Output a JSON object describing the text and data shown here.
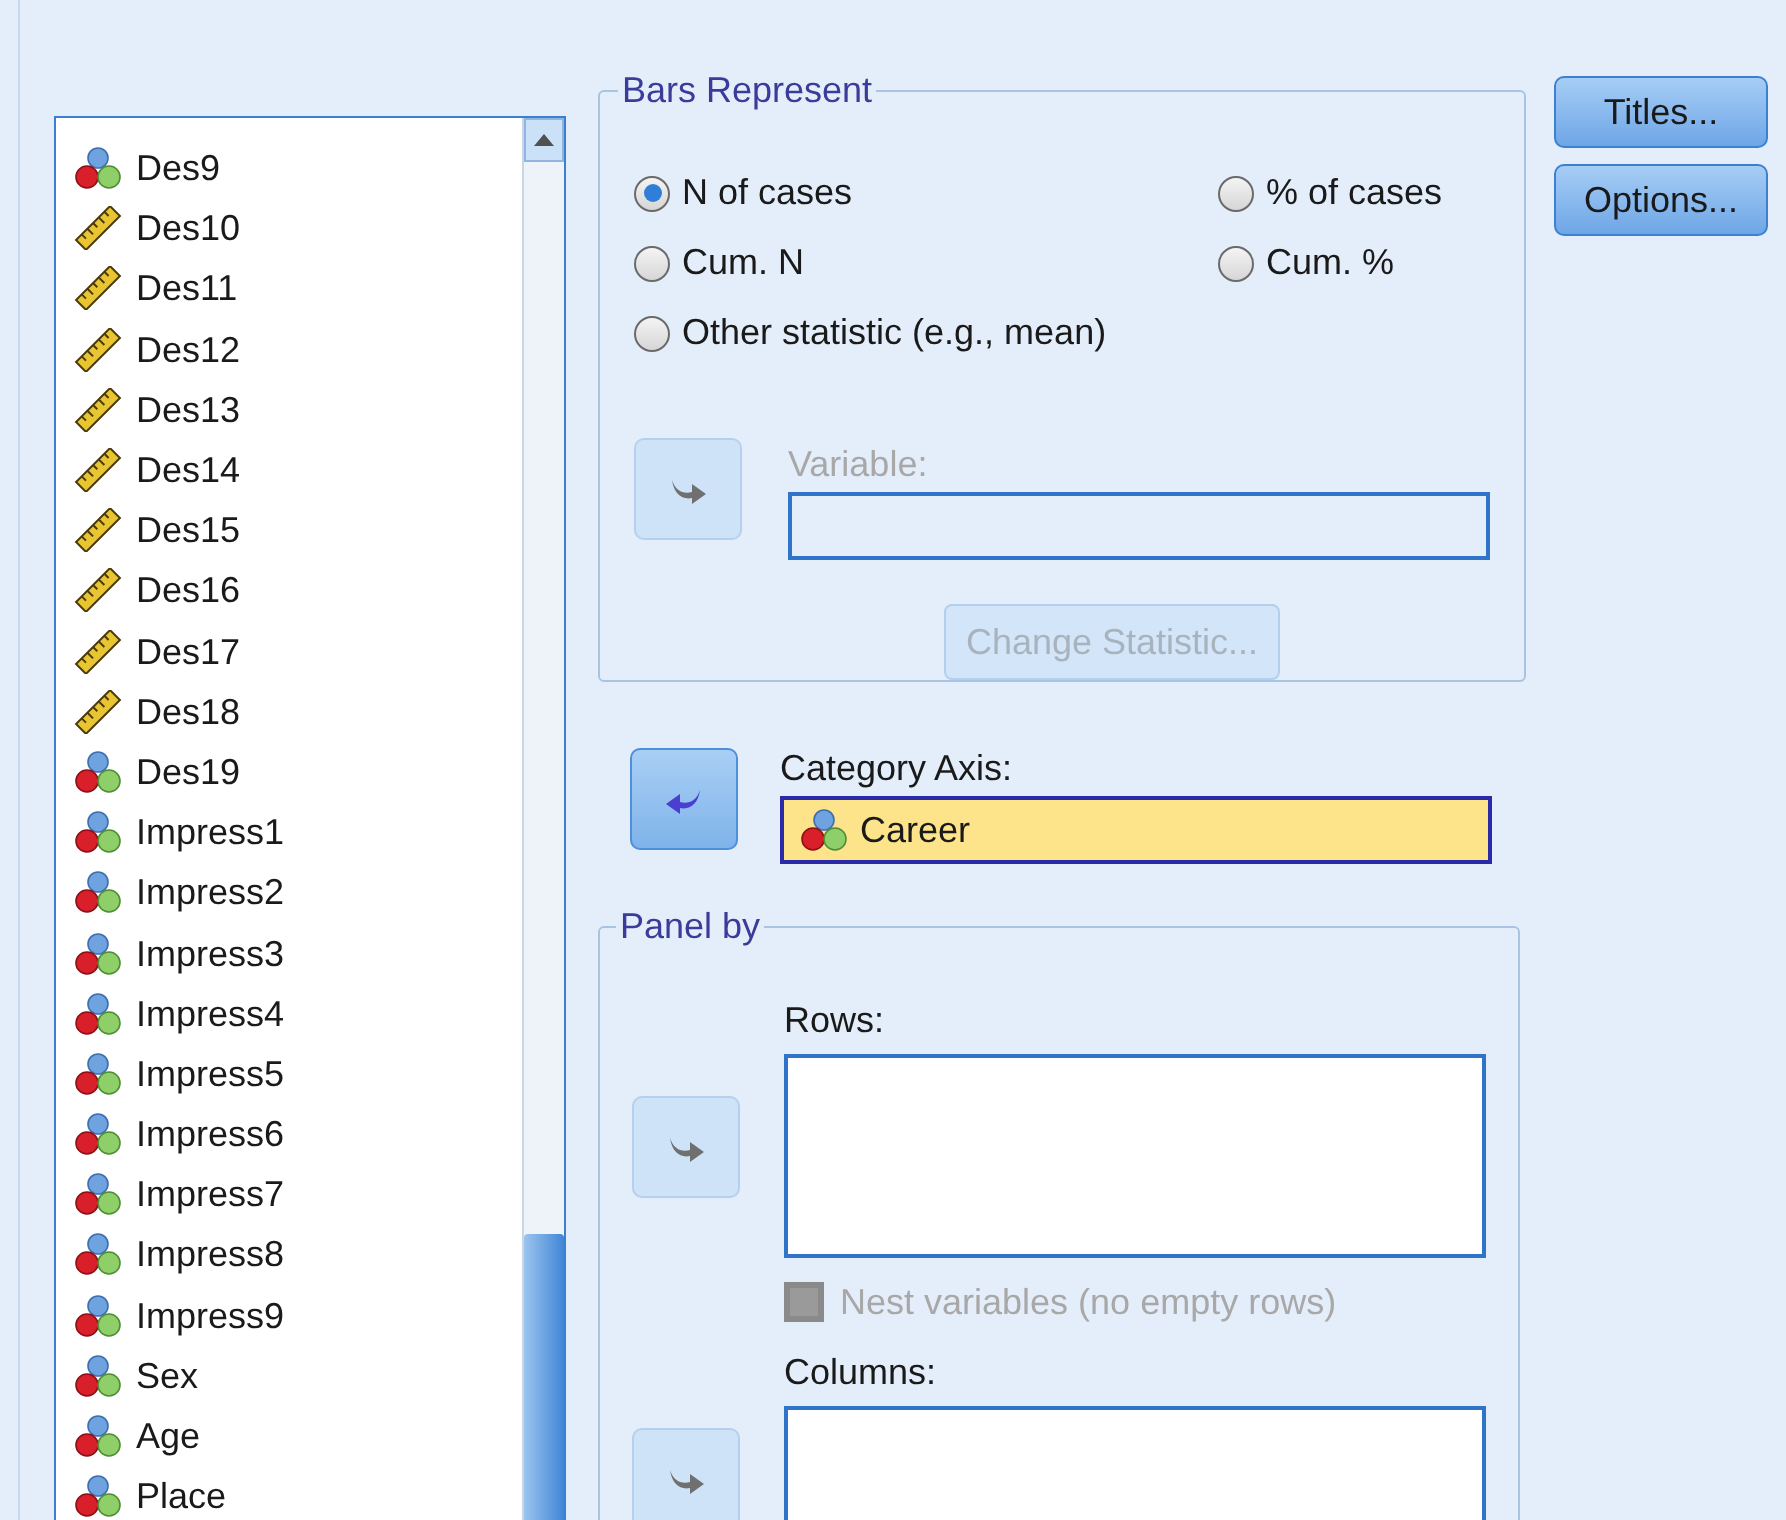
{
  "variables": [
    {
      "name": "Des9",
      "kind": "nominal"
    },
    {
      "name": "Des10",
      "kind": "scale"
    },
    {
      "name": "Des11",
      "kind": "scale"
    },
    {
      "name": "Des12",
      "kind": "scale"
    },
    {
      "name": "Des13",
      "kind": "scale"
    },
    {
      "name": "Des14",
      "kind": "scale"
    },
    {
      "name": "Des15",
      "kind": "scale"
    },
    {
      "name": "Des16",
      "kind": "scale"
    },
    {
      "name": "Des17",
      "kind": "scale"
    },
    {
      "name": "Des18",
      "kind": "scale"
    },
    {
      "name": "Des19",
      "kind": "nominal"
    },
    {
      "name": "Impress1",
      "kind": "nominal"
    },
    {
      "name": "Impress2",
      "kind": "nominal"
    },
    {
      "name": "Impress3",
      "kind": "nominal"
    },
    {
      "name": "Impress4",
      "kind": "nominal"
    },
    {
      "name": "Impress5",
      "kind": "nominal"
    },
    {
      "name": "Impress6",
      "kind": "nominal"
    },
    {
      "name": "Impress7",
      "kind": "nominal"
    },
    {
      "name": "Impress8",
      "kind": "nominal"
    },
    {
      "name": "Impress9",
      "kind": "nominal"
    },
    {
      "name": "Sex",
      "kind": "nominal"
    },
    {
      "name": "Age",
      "kind": "nominal"
    },
    {
      "name": "Place",
      "kind": "nominal"
    }
  ],
  "bars_represent": {
    "title": "Bars Represent",
    "options": [
      {
        "label": "N of cases",
        "selected": true
      },
      {
        "label": "% of cases",
        "selected": false
      },
      {
        "label": "Cum. N",
        "selected": false
      },
      {
        "label": "Cum. %",
        "selected": false
      },
      {
        "label": "Other statistic (e.g., mean)",
        "selected": false
      }
    ],
    "move_button": {
      "points_left": false,
      "disabled": true
    },
    "variable_label": "Variable:",
    "variable_disabled": true,
    "change_statistic": {
      "label": "Change Statistic...",
      "disabled": true
    }
  },
  "category_axis": {
    "move_button": {
      "points_left": true,
      "disabled": false
    },
    "label": "Category Axis:",
    "value": "Career",
    "kind": "nominal"
  },
  "panel_by": {
    "title": "Panel by",
    "rows": {
      "move_button": {
        "points_left": false,
        "disabled": true
      },
      "label": "Rows:"
    },
    "nest": {
      "label": "Nest variables (no empty rows)",
      "checked": false,
      "disabled": true
    },
    "columns": {
      "move_button": {
        "points_left": false,
        "disabled": true
      },
      "label": "Columns:"
    }
  },
  "buttons": [
    "Titles...",
    "Options..."
  ]
}
